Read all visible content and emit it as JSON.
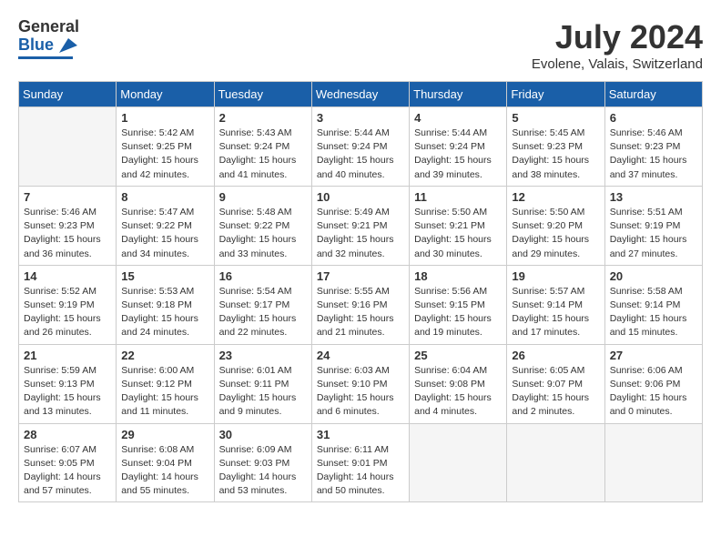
{
  "header": {
    "logo_general": "General",
    "logo_blue": "Blue",
    "month_title": "July 2024",
    "location": "Evolene, Valais, Switzerland"
  },
  "calendar": {
    "weekdays": [
      "Sunday",
      "Monday",
      "Tuesday",
      "Wednesday",
      "Thursday",
      "Friday",
      "Saturday"
    ],
    "weeks": [
      [
        {
          "day": null
        },
        {
          "day": "1",
          "sunrise": "5:42 AM",
          "sunset": "9:25 PM",
          "daylight": "15 hours and 42 minutes."
        },
        {
          "day": "2",
          "sunrise": "5:43 AM",
          "sunset": "9:24 PM",
          "daylight": "15 hours and 41 minutes."
        },
        {
          "day": "3",
          "sunrise": "5:44 AM",
          "sunset": "9:24 PM",
          "daylight": "15 hours and 40 minutes."
        },
        {
          "day": "4",
          "sunrise": "5:44 AM",
          "sunset": "9:24 PM",
          "daylight": "15 hours and 39 minutes."
        },
        {
          "day": "5",
          "sunrise": "5:45 AM",
          "sunset": "9:23 PM",
          "daylight": "15 hours and 38 minutes."
        },
        {
          "day": "6",
          "sunrise": "5:46 AM",
          "sunset": "9:23 PM",
          "daylight": "15 hours and 37 minutes."
        }
      ],
      [
        {
          "day": "7",
          "sunrise": "5:46 AM",
          "sunset": "9:23 PM",
          "daylight": "15 hours and 36 minutes."
        },
        {
          "day": "8",
          "sunrise": "5:47 AM",
          "sunset": "9:22 PM",
          "daylight": "15 hours and 34 minutes."
        },
        {
          "day": "9",
          "sunrise": "5:48 AM",
          "sunset": "9:22 PM",
          "daylight": "15 hours and 33 minutes."
        },
        {
          "day": "10",
          "sunrise": "5:49 AM",
          "sunset": "9:21 PM",
          "daylight": "15 hours and 32 minutes."
        },
        {
          "day": "11",
          "sunrise": "5:50 AM",
          "sunset": "9:21 PM",
          "daylight": "15 hours and 30 minutes."
        },
        {
          "day": "12",
          "sunrise": "5:50 AM",
          "sunset": "9:20 PM",
          "daylight": "15 hours and 29 minutes."
        },
        {
          "day": "13",
          "sunrise": "5:51 AM",
          "sunset": "9:19 PM",
          "daylight": "15 hours and 27 minutes."
        }
      ],
      [
        {
          "day": "14",
          "sunrise": "5:52 AM",
          "sunset": "9:19 PM",
          "daylight": "15 hours and 26 minutes."
        },
        {
          "day": "15",
          "sunrise": "5:53 AM",
          "sunset": "9:18 PM",
          "daylight": "15 hours and 24 minutes."
        },
        {
          "day": "16",
          "sunrise": "5:54 AM",
          "sunset": "9:17 PM",
          "daylight": "15 hours and 22 minutes."
        },
        {
          "day": "17",
          "sunrise": "5:55 AM",
          "sunset": "9:16 PM",
          "daylight": "15 hours and 21 minutes."
        },
        {
          "day": "18",
          "sunrise": "5:56 AM",
          "sunset": "9:15 PM",
          "daylight": "15 hours and 19 minutes."
        },
        {
          "day": "19",
          "sunrise": "5:57 AM",
          "sunset": "9:14 PM",
          "daylight": "15 hours and 17 minutes."
        },
        {
          "day": "20",
          "sunrise": "5:58 AM",
          "sunset": "9:14 PM",
          "daylight": "15 hours and 15 minutes."
        }
      ],
      [
        {
          "day": "21",
          "sunrise": "5:59 AM",
          "sunset": "9:13 PM",
          "daylight": "15 hours and 13 minutes."
        },
        {
          "day": "22",
          "sunrise": "6:00 AM",
          "sunset": "9:12 PM",
          "daylight": "15 hours and 11 minutes."
        },
        {
          "day": "23",
          "sunrise": "6:01 AM",
          "sunset": "9:11 PM",
          "daylight": "15 hours and 9 minutes."
        },
        {
          "day": "24",
          "sunrise": "6:03 AM",
          "sunset": "9:10 PM",
          "daylight": "15 hours and 6 minutes."
        },
        {
          "day": "25",
          "sunrise": "6:04 AM",
          "sunset": "9:08 PM",
          "daylight": "15 hours and 4 minutes."
        },
        {
          "day": "26",
          "sunrise": "6:05 AM",
          "sunset": "9:07 PM",
          "daylight": "15 hours and 2 minutes."
        },
        {
          "day": "27",
          "sunrise": "6:06 AM",
          "sunset": "9:06 PM",
          "daylight": "15 hours and 0 minutes."
        }
      ],
      [
        {
          "day": "28",
          "sunrise": "6:07 AM",
          "sunset": "9:05 PM",
          "daylight": "14 hours and 57 minutes."
        },
        {
          "day": "29",
          "sunrise": "6:08 AM",
          "sunset": "9:04 PM",
          "daylight": "14 hours and 55 minutes."
        },
        {
          "day": "30",
          "sunrise": "6:09 AM",
          "sunset": "9:03 PM",
          "daylight": "14 hours and 53 minutes."
        },
        {
          "day": "31",
          "sunrise": "6:11 AM",
          "sunset": "9:01 PM",
          "daylight": "14 hours and 50 minutes."
        },
        {
          "day": null
        },
        {
          "day": null
        },
        {
          "day": null
        }
      ]
    ]
  }
}
